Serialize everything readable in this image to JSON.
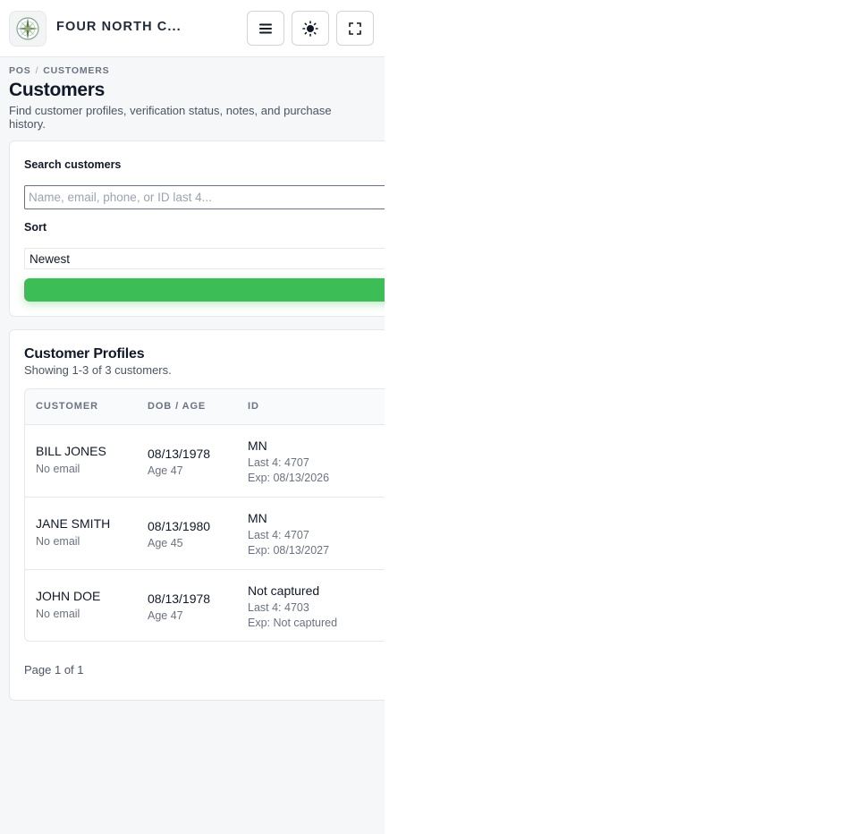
{
  "header": {
    "brand": "FOUR NORTH C...",
    "logo_icon": "compass-icon",
    "menu_icon": "hamburger-icon",
    "theme_icon": "sun-icon",
    "fullscreen_icon": "fullscreen-icon"
  },
  "breadcrumb": {
    "root": "POS",
    "separator": "/",
    "current": "CUSTOMERS"
  },
  "page": {
    "title": "Customers",
    "subtitle": "Find customer profiles, verification status, notes, and purchase history."
  },
  "search": {
    "label": "Search customers",
    "placeholder": "Name, email, phone, or ID last 4...",
    "sort_label": "Sort",
    "sort_value": "Newest",
    "button_color": "#3dbd56"
  },
  "profiles": {
    "title": "Customer Profiles",
    "showing": "Showing 1-3 of 3 customers.",
    "columns": [
      "CUSTOMER",
      "DOB / AGE",
      "ID"
    ],
    "rows": [
      {
        "name": "BILL JONES",
        "email": "No email",
        "dob": "08/13/1978",
        "age": "Age 47",
        "id_state": "MN",
        "last4": "Last 4: 4707",
        "exp": "Exp: 08/13/2026"
      },
      {
        "name": "JANE SMITH",
        "email": "No email",
        "dob": "08/13/1980",
        "age": "Age 45",
        "id_state": "MN",
        "last4": "Last 4: 4707",
        "exp": "Exp: 08/13/2027"
      },
      {
        "name": "JOHN DOE",
        "email": "No email",
        "dob": "08/13/1978",
        "age": "Age 47",
        "id_state": "Not captured",
        "last4": "Last 4: 4703",
        "exp": "Exp: Not captured"
      }
    ],
    "pagination": "Page 1 of 1"
  }
}
